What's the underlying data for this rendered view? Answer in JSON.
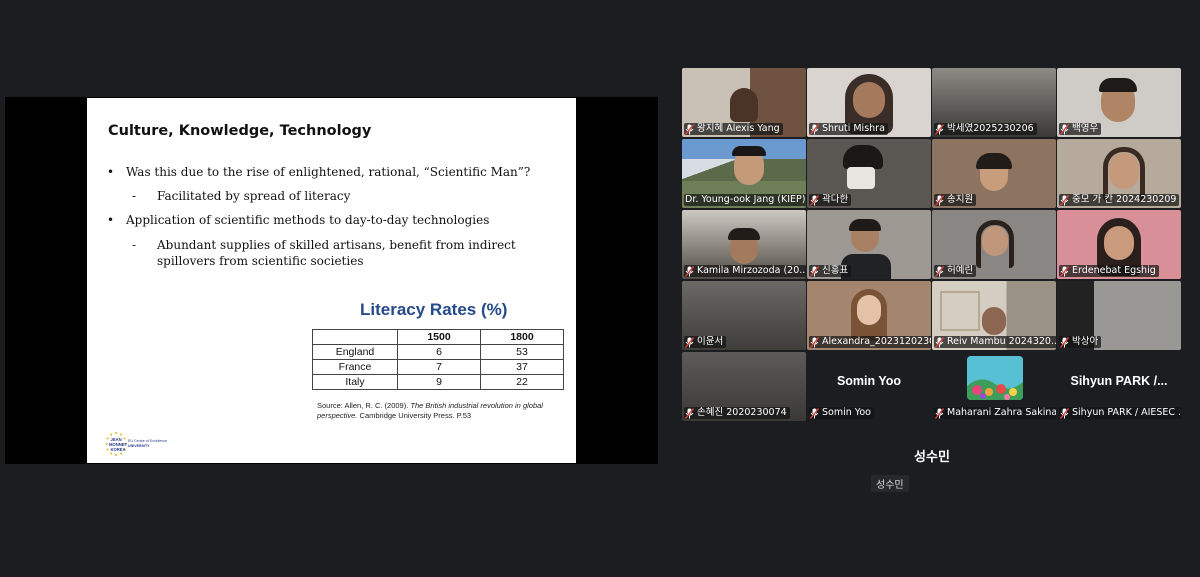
{
  "slide": {
    "title": "Culture, Knowledge, Technology",
    "bullets": [
      {
        "text": "Was this due to the rise of enlightened, rational, “Scientific Man”?"
      },
      {
        "text": "Application of scientific methods to day-to-day technologies"
      }
    ],
    "subbullets": [
      {
        "text": "Facilitated by spread of literacy"
      },
      {
        "text": "Abundant supplies of skilled artisans, benefit from indirect spillovers from scientific societies"
      }
    ],
    "bullet_symbol": "•",
    "dash_symbol": "-",
    "table": {
      "title": "Literacy Rates (%)",
      "headers": [
        "",
        "1500",
        "1800"
      ],
      "rows": [
        [
          "England",
          "6",
          "53"
        ],
        [
          "France",
          "7",
          "37"
        ],
        [
          "Italy",
          "9",
          "22"
        ]
      ]
    },
    "source": {
      "prefix": "Source: Allen, R. C. (2009). ",
      "italic": "The British industrial revolution in global perspective.",
      "suffix": " Cambridge University Press. P.53"
    },
    "logo": {
      "line1": "JEAN",
      "line2": "MONNET",
      "line3": "KOREA",
      "right1": "EU Centre of Excellence",
      "right2": "UNIVERSITY"
    }
  },
  "participants": [
    {
      "name": "왕지혜 Alexis Yang",
      "muted": true,
      "bg": "#b7b0a6"
    },
    {
      "name": "Shruti Mishra",
      "muted": true,
      "bg": "#a8a39e"
    },
    {
      "name": "박세였2025230206",
      "muted": true,
      "bg": "#6b6a66"
    },
    {
      "name": "백영우",
      "muted": true,
      "bg": "#b9b6b2"
    },
    {
      "name": "Dr. Young-ook Jang (KIEP)",
      "muted": false,
      "bg": "#5f86b8",
      "active": true
    },
    {
      "name": "곽다한",
      "muted": true,
      "bg": "#4e4b47"
    },
    {
      "name": "송지원",
      "muted": true,
      "bg": "#8a7563"
    },
    {
      "name": "중모 가 칸 2024230209",
      "muted": true,
      "bg": "#a59a8c"
    },
    {
      "name": "Kamila Mirzozoda (20...",
      "muted": true,
      "bg": "#6e6862"
    },
    {
      "name": "신홍표",
      "muted": true,
      "bg": "#8c8782"
    },
    {
      "name": "허예린",
      "muted": true,
      "bg": "#7f7b78"
    },
    {
      "name": "Erdenebat Egshig",
      "muted": true,
      "bg": "#c97a84"
    },
    {
      "name": "이윤서",
      "muted": true,
      "bg": "#5c5a57"
    },
    {
      "name": "Alexandra_2023120230",
      "muted": true,
      "bg": "#9c8472"
    },
    {
      "name": "Reiv Mambu 2024320...",
      "muted": true,
      "bg": "#b9b2a7"
    },
    {
      "name": "박상아",
      "muted": true,
      "bg": "#8d8b88"
    },
    {
      "name": "손혜진 2020230074",
      "muted": true,
      "bg": "#5a5856"
    },
    {
      "name": "Somin Yoo",
      "muted": true,
      "bg": "#2b2d31",
      "placeholder": "Somin Yoo"
    },
    {
      "name": "Maharani Zahra Sakina",
      "muted": true,
      "bg": "#2b2d31",
      "avatar": true
    },
    {
      "name": "Sihyun PARK / AIESEC ...",
      "muted": true,
      "bg": "#2b2d31",
      "placeholder": "Sihyun PARK /..."
    }
  ],
  "self_view": {
    "big_name": "성수민",
    "small_name": "성수민"
  },
  "colors": {
    "mute_red": "#e0433d",
    "active_border": "#2fd45b",
    "table_title": "#254a8a"
  }
}
